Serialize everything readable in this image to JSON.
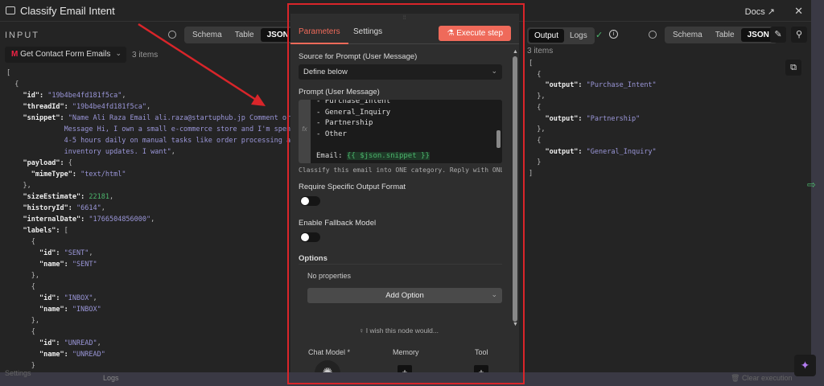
{
  "title": "Classify Email Intent",
  "docs": "Docs",
  "input": {
    "label": "INPUT",
    "views": [
      "Schema",
      "Table",
      "JSON"
    ],
    "active_view": "JSON",
    "source": "Get Contact Form Emails",
    "items": "3 items",
    "lines": [
      [
        "0",
        "",
        "[",
        ""
      ],
      [
        "1",
        "",
        "{",
        ""
      ],
      [
        "2",
        "\"id\": ",
        "\"19b4be4fd181f5ca\"",
        ","
      ],
      [
        "2",
        "\"threadId\": ",
        "\"19b4be4fd181f5ca\"",
        ","
      ],
      [
        "2",
        "\"snippet\": ",
        "\"Name Ali Raza Email ali.raza@startuphub.jp Comment or",
        ""
      ],
      [
        "7",
        "",
        "Message Hi, I own a small e-commerce store and I'm spending",
        ""
      ],
      [
        "7",
        "",
        "4-5 hours daily on manual tasks like order processing and",
        ""
      ],
      [
        "7",
        "",
        "inventory updates. I want\"",
        ","
      ],
      [
        "2",
        "\"payload\": ",
        "{",
        ""
      ],
      [
        "3",
        "\"mimeType\": ",
        "\"text/html\"",
        ""
      ],
      [
        "2",
        "",
        "},",
        ""
      ],
      [
        "2",
        "\"sizeEstimate\": ",
        "22181",
        ","
      ],
      [
        "2",
        "\"historyId\": ",
        "\"6614\"",
        ","
      ],
      [
        "2",
        "\"internalDate\": ",
        "\"1766504856000\"",
        ","
      ],
      [
        "2",
        "\"labels\": ",
        "[",
        ""
      ],
      [
        "3",
        "",
        "{",
        ""
      ],
      [
        "4",
        "\"id\": ",
        "\"SENT\"",
        ","
      ],
      [
        "4",
        "\"name\": ",
        "\"SENT\"",
        ""
      ],
      [
        "3",
        "",
        "},",
        ""
      ],
      [
        "3",
        "",
        "{",
        ""
      ],
      [
        "4",
        "\"id\": ",
        "\"INBOX\"",
        ","
      ],
      [
        "4",
        "\"name\": ",
        "\"INBOX\"",
        ""
      ],
      [
        "3",
        "",
        "},",
        ""
      ],
      [
        "3",
        "",
        "{",
        ""
      ],
      [
        "4",
        "\"id\": ",
        "\"UNREAD\"",
        ","
      ],
      [
        "4",
        "\"name\": ",
        "\"UNREAD\"",
        ""
      ],
      [
        "3",
        "",
        "}",
        ""
      ]
    ]
  },
  "params": {
    "tabs": [
      "Parameters",
      "Settings"
    ],
    "active_tab": "Parameters",
    "execute": "Execute step",
    "source_label": "Source for Prompt (User Message)",
    "source_value": "Define below",
    "prompt_label": "Prompt (User Message)",
    "prompt_lines": [
      "- Purchase_Intent",
      "- General_Inquiry",
      "- Partnership",
      "- Other",
      "",
      ""
    ],
    "prompt_email_prefix": "Email: ",
    "prompt_expr": "{{ $json.snippet }}",
    "prompt_hint": "Classify this email into ONE category. Reply with ONLY …",
    "require_format_label": "Require Specific Output Format",
    "require_format_on": false,
    "fallback_label": "Enable Fallback Model",
    "fallback_on": false,
    "options_label": "Options",
    "no_properties": "No properties",
    "add_option": "Add Option",
    "wish": "I wish this node would...",
    "subnodes": [
      "Chat Model *",
      "Memory",
      "Tool"
    ]
  },
  "output": {
    "tabs": [
      "Output",
      "Logs"
    ],
    "views": [
      "Schema",
      "Table",
      "JSON"
    ],
    "active_view": "JSON",
    "items": "3 items",
    "values": [
      "Purchase_Intent",
      "Partnership",
      "General_Inquiry"
    ],
    "key": "\"output\": "
  },
  "bottom": {
    "logs": "Logs",
    "clear": "Clear execution",
    "settings": "Settings"
  },
  "colors": {
    "accent": "#ef6a5a",
    "annotation": "#d9252a",
    "success": "#4cb56c"
  }
}
